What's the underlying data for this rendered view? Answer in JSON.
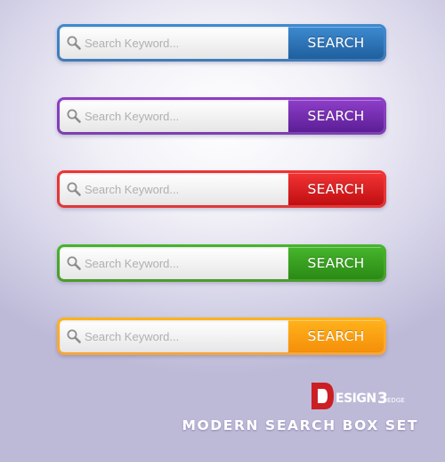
{
  "search_boxes": [
    {
      "id": "blue",
      "placeholder": "Search Keyword...",
      "button_label": "SEARCH",
      "border_color": "#3f7bb8",
      "button_top": "#3d8ad0",
      "button_bottom": "#1f5f9e"
    },
    {
      "id": "purple",
      "placeholder": "Search Keyword...",
      "button_label": "SEARCH",
      "border_color": "#7d40b0",
      "button_top": "#8e3ec9",
      "button_bottom": "#5c1e96"
    },
    {
      "id": "red",
      "placeholder": "Search Keyword...",
      "button_label": "SEARCH",
      "border_color": "#e0383a",
      "button_top": "#f23333",
      "button_bottom": "#c00f12"
    },
    {
      "id": "green",
      "placeholder": "Search Keyword...",
      "button_label": "SEARCH",
      "border_color": "#4a9c2d",
      "button_top": "#46b52c",
      "button_bottom": "#2a8a15"
    },
    {
      "id": "orange",
      "placeholder": "Search Keyword...",
      "button_label": "SEARCH",
      "border_color": "#f6a53b",
      "button_top": "#ffb21b",
      "button_bottom": "#f58f0a"
    }
  ],
  "search_icon": "magnifier-icon",
  "footer": {
    "logo_text": "DESIGN3EDGE",
    "logo_colors": {
      "mark": "#cc1f24",
      "text": "#ffffff"
    },
    "title": "MODERN SEARCH BOX SET"
  }
}
